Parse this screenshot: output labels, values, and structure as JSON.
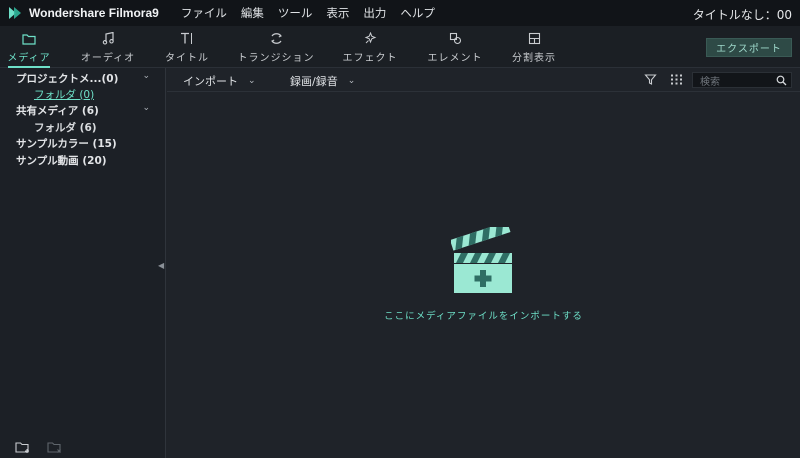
{
  "app": {
    "name": "Wondershare Filmora9",
    "document_title": "タイトルなし：00",
    "accent_color": "#6ee0c8"
  },
  "menu": [
    "ファイル",
    "編集",
    "ツール",
    "表示",
    "出力",
    "ヘルプ"
  ],
  "tabs": [
    {
      "label": "メディア",
      "icon": "folder-icon",
      "active": true
    },
    {
      "label": "オーディオ",
      "icon": "music-note-icon",
      "active": false
    },
    {
      "label": "タイトル",
      "icon": "text-title-icon",
      "active": false
    },
    {
      "label": "トランジション",
      "icon": "transition-icon",
      "active": false
    },
    {
      "label": "エフェクト",
      "icon": "effects-sparkle-icon",
      "active": false
    },
    {
      "label": "エレメント",
      "icon": "elements-icon",
      "active": false
    },
    {
      "label": "分割表示",
      "icon": "split-screen-icon",
      "active": false
    }
  ],
  "export_button": "エクスポート",
  "tree": {
    "project_media": "プロジェクトメ...(0)",
    "project_folder": "フォルダ (0)",
    "shared_media": "共有メディア (6)",
    "shared_folder": "フォルダ (6)",
    "sample_colors": "サンプルカラー (15)",
    "sample_videos": "サンプル動画 (20)"
  },
  "subbar": {
    "import_label": "インポート",
    "record_label": "録画/録音",
    "search_placeholder": "検索"
  },
  "dropzone": {
    "hint": "ここにメディアファイルをインポートする"
  }
}
